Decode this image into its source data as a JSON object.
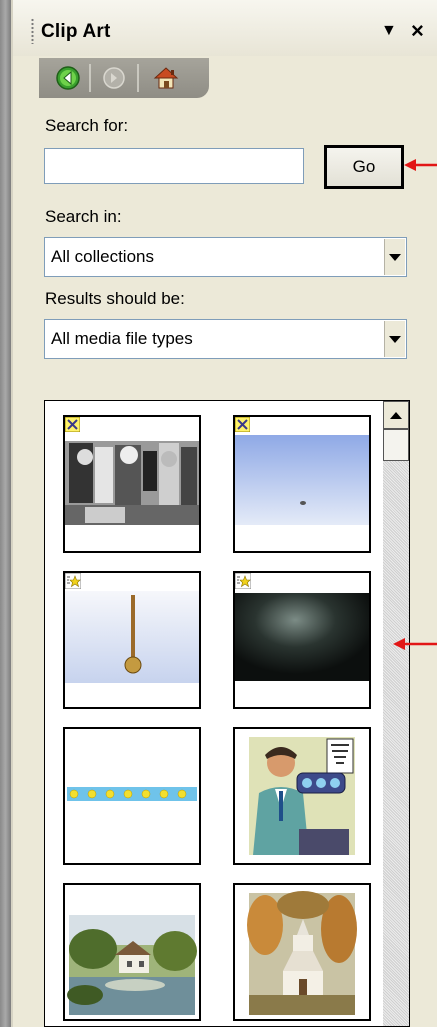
{
  "pane": {
    "title": "Clip Art",
    "menu_icon": "▼",
    "close_icon": "×"
  },
  "nav": {
    "back_icon": "back-arrow-icon",
    "forward_icon": "forward-arrow-icon",
    "home_icon": "home-icon"
  },
  "search": {
    "label": "Search for:",
    "value": "",
    "go_label": "Go"
  },
  "search_in": {
    "label": "Search in:",
    "selected": "All collections"
  },
  "results_type": {
    "label": "Results should be:",
    "selected": "All media file types"
  },
  "results": {
    "items": [
      {
        "subject": "black and white crowd photo",
        "badges": [
          "x-badge"
        ]
      },
      {
        "subject": "blue sky with bird",
        "badges": [
          "x-badge"
        ]
      },
      {
        "subject": "golden pendulum",
        "badges": [
          "x-badge",
          "star-badge"
        ]
      },
      {
        "subject": "dark smoke animation",
        "badges": [
          "x-badge",
          "star-badge"
        ]
      },
      {
        "subject": "blue star border strip",
        "badges": []
      },
      {
        "subject": "eye exam illustration",
        "badges": []
      },
      {
        "subject": "house by the lake painting",
        "badges": []
      },
      {
        "subject": "church in autumn trees painting",
        "badges": []
      }
    ]
  },
  "colors": {
    "annotation_arrow": "#e21616",
    "panel_bg": "#ece9d8"
  }
}
